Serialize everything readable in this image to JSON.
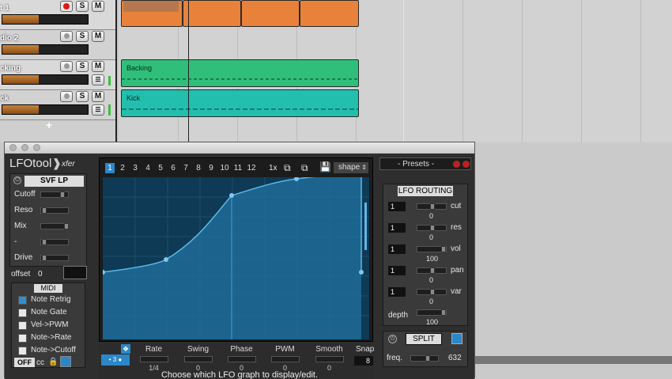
{
  "tracks": [
    {
      "name": "t 1",
      "armed": true,
      "meter": 0.43
    },
    {
      "name": "dio 2",
      "armed": false,
      "meter": 0.43
    },
    {
      "name": "cking",
      "armed": false,
      "meter": 0.43
    },
    {
      "name": "ck",
      "armed": false,
      "meter": 0.43
    }
  ],
  "track_buttons": {
    "solo": "S",
    "mute": "M",
    "add": "+"
  },
  "clips": {
    "backing": "Backing",
    "kick": "Kick"
  },
  "plugin": {
    "logo": "LFOtool",
    "brand": "xfer",
    "filter_type": "SVF LP",
    "knobs": [
      "Cutoff",
      "Reso",
      "Mix",
      "-",
      "Drive"
    ],
    "offset_label": "offset",
    "offset_value": "0",
    "midi_title": "MIDI",
    "midi_options": [
      {
        "label": "Note Retrig",
        "checked": true
      },
      {
        "label": "Note Gate",
        "checked": false
      },
      {
        "label": "Vel->PWM",
        "checked": false
      },
      {
        "label": "Note->Rate",
        "checked": false
      },
      {
        "label": "Note->Cutoff",
        "checked": false
      }
    ],
    "off_label": "OFF",
    "cc_label": "cc",
    "graph_tabs": [
      "1",
      "2",
      "3",
      "4",
      "5",
      "6",
      "7",
      "8",
      "9",
      "10",
      "11",
      "12"
    ],
    "selected_tab": "1",
    "multiplier": "1x",
    "shape_label": "shape",
    "controls": [
      {
        "label": "Rate",
        "value": "1/4"
      },
      {
        "label": "Swing",
        "value": "0"
      },
      {
        "label": "Phase",
        "value": "0"
      },
      {
        "label": "PWM",
        "value": "0"
      },
      {
        "label": "Smooth",
        "value": "0"
      }
    ],
    "snap_label": "Snap",
    "snap_value": "8",
    "presets_label": "- Presets -",
    "routing_title": "LFO ROUTING",
    "routes": [
      {
        "graph": "1",
        "target": "cut",
        "value": "0"
      },
      {
        "graph": "1",
        "target": "res",
        "value": "0"
      },
      {
        "graph": "1",
        "target": "vol",
        "value": "100"
      },
      {
        "graph": "1",
        "target": "pan",
        "value": "0"
      },
      {
        "graph": "1",
        "target": "var",
        "value": "0"
      }
    ],
    "depth_label": "depth",
    "depth_value": "100",
    "split_label": "SPLIT",
    "freq_label": "freq.",
    "freq_value": "632",
    "status": "Choose which LFO graph to display/edit."
  },
  "colors": {
    "accent": "#2b87c8",
    "orange": "#e8823a",
    "green": "#2fbf7a",
    "teal": "#22bfae"
  }
}
